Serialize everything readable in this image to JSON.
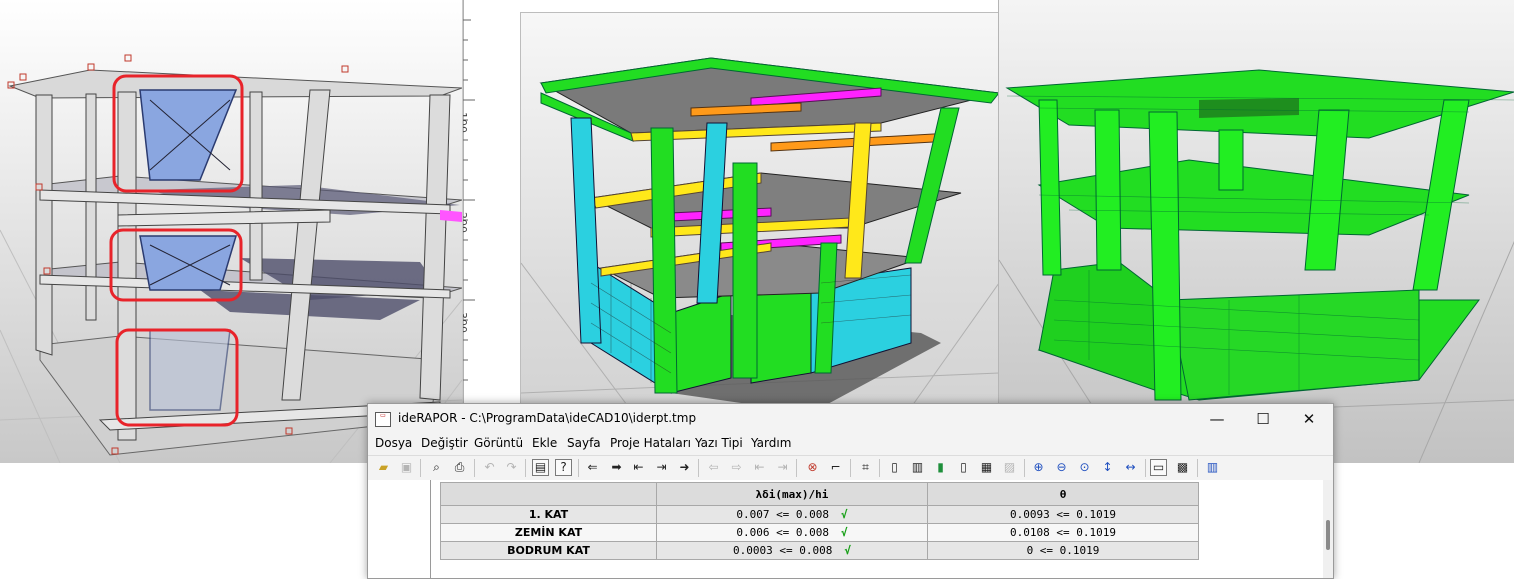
{
  "viewport_left": {
    "ruler_ticks": [
      "100",
      "200",
      "300"
    ]
  },
  "report_window": {
    "title": "ideRAPOR - C:\\ProgramData\\ideCAD10\\iderpt.tmp",
    "controls": {
      "minimize": "—",
      "maximize": "☐",
      "close": "✕"
    },
    "menu": [
      "Dosya",
      "Değiştir",
      "Görüntü",
      "Ekle",
      "Sayfa",
      "Proje Hataları",
      "Yazı Tipi",
      "Yardım"
    ],
    "table": {
      "headers": [
        "",
        "λδi(max)/hi",
        "θ"
      ],
      "rows": [
        {
          "label": "1. KAT",
          "drift": "0.007 <= 0.008",
          "theta": "0.0093 <= 0.1019"
        },
        {
          "label": "ZEMİN KAT",
          "drift": "0.006 <= 0.008",
          "theta": "0.0108 <= 0.1019"
        },
        {
          "label": "BODRUM KAT",
          "drift": "0.0003 <= 0.008",
          "theta": "0 <= 0.1019"
        }
      ],
      "check_mark": "√"
    }
  },
  "colors": {
    "highlight_box": "#e8232a",
    "green_members": "#22dd22",
    "cyan_members": "#27e3f0",
    "magenta_members": "#ff22ff",
    "yellow_members": "#ffe81a",
    "orange_members": "#ff9a1a"
  }
}
